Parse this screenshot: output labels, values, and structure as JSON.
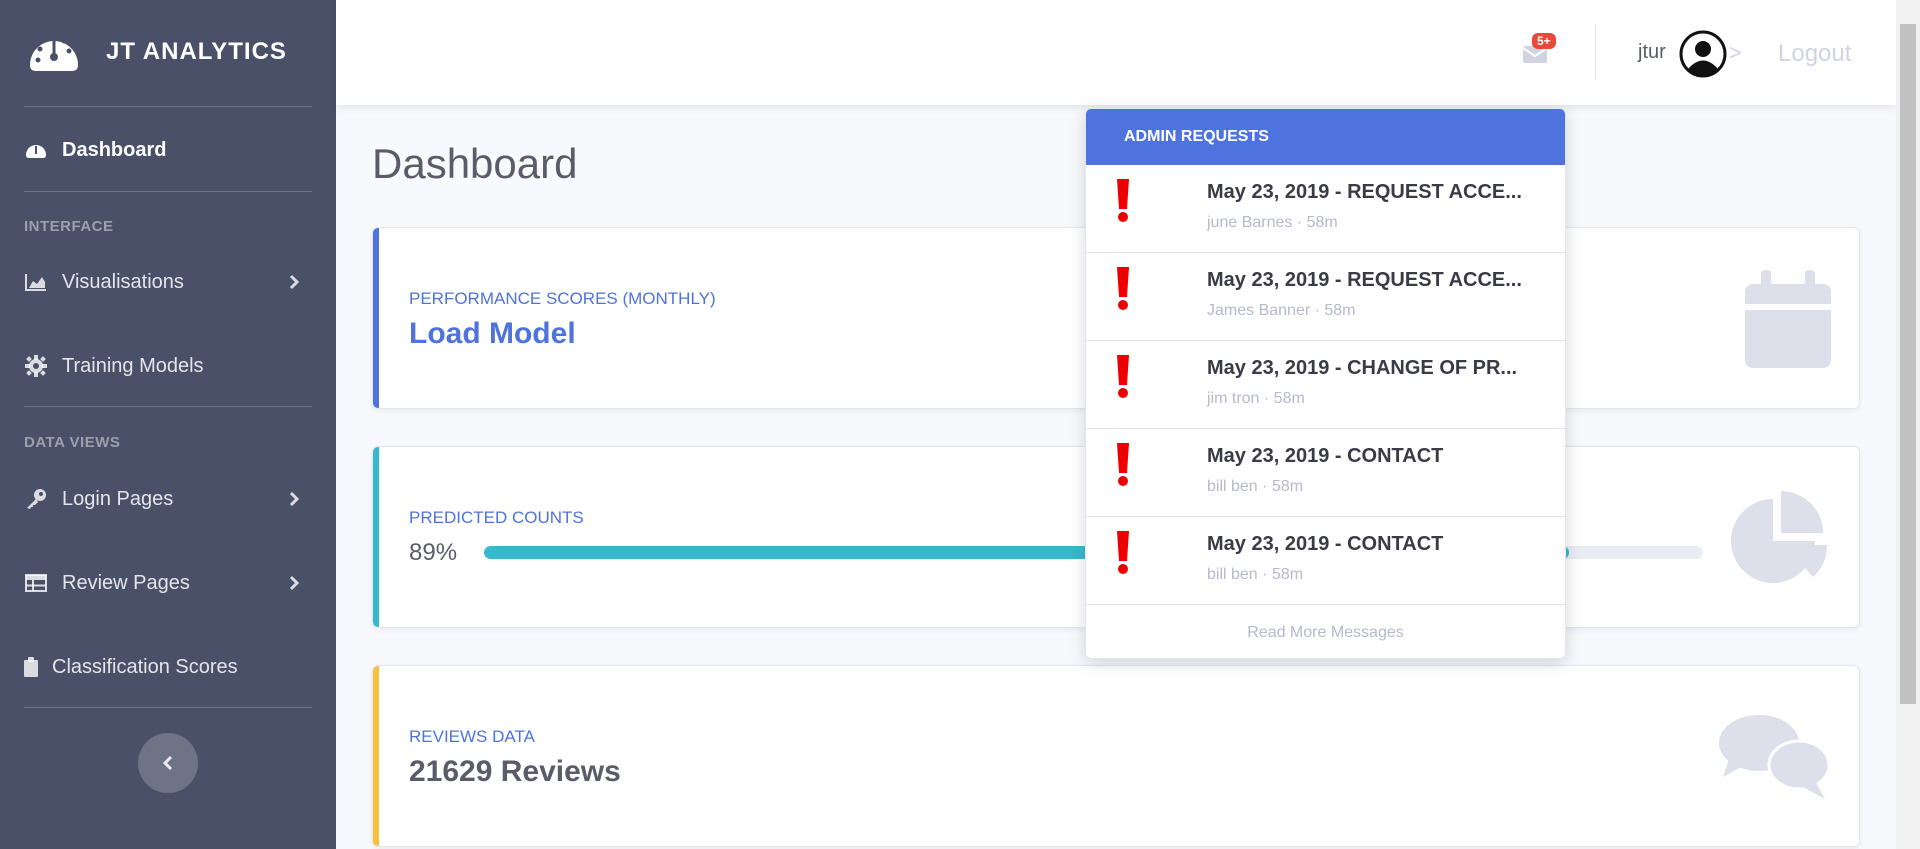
{
  "brand": {
    "name": "JT ANALYTICS",
    "logo_icon": "tachometer-icon"
  },
  "sidebar": {
    "dashboard": {
      "label": "Dashboard",
      "icon": "tachometer-icon"
    },
    "heading_interface": "INTERFACE",
    "visualisations": {
      "label": "Visualisations",
      "icon": "area-chart-icon"
    },
    "training_models": {
      "label": "Training Models",
      "icon": "gear-icon"
    },
    "heading_data_views": "DATA VIEWS",
    "login_pages": {
      "label": "Login Pages",
      "icon": "key-icon"
    },
    "review_pages": {
      "label": "Review Pages",
      "icon": "table-icon"
    },
    "classification_scores": {
      "label": "Classification Scores",
      "icon": "clipboard-icon"
    },
    "toggle_icon": "chevron-left-icon"
  },
  "topbar": {
    "mail_badge": "5+",
    "username": "jtur",
    "separator": ">",
    "logout": "Logout"
  },
  "main": {
    "title": "Dashboard",
    "cards": [
      {
        "label": "Performance Scores (Monthly)",
        "value": "Load Model",
        "accent": "#4e73df",
        "icon": "calendar-icon"
      },
      {
        "label": "Predicted Counts",
        "value": "89%",
        "progress": 0.89,
        "accent": "#36b9cc",
        "icon": "pie-chart-icon"
      },
      {
        "label": "Reviews Data",
        "value": "21629 Reviews",
        "accent": "#f6c23e",
        "icon": "comments-icon"
      }
    ]
  },
  "dropdown": {
    "header": "Admin Requests",
    "items": [
      {
        "title": "May 23, 2019 - REQUEST ACCE...",
        "meta": "june Barnes · 58m"
      },
      {
        "title": "May 23, 2019 - REQUEST ACCE...",
        "meta": "James Banner · 58m"
      },
      {
        "title": "May 23, 2019 - CHANGE OF PR...",
        "meta": "jim tron · 58m"
      },
      {
        "title": "May 23, 2019 - CONTACT",
        "meta": "bill ben · 58m"
      },
      {
        "title": "May 23, 2019 - CONTACT",
        "meta": "bill ben · 58m"
      }
    ],
    "footer": "Read More Messages"
  },
  "colors": {
    "sidebar": "#4a5068",
    "primary": "#4e73df",
    "info": "#36b9cc",
    "warning": "#f6c23e",
    "danger": "#e74a3b"
  }
}
